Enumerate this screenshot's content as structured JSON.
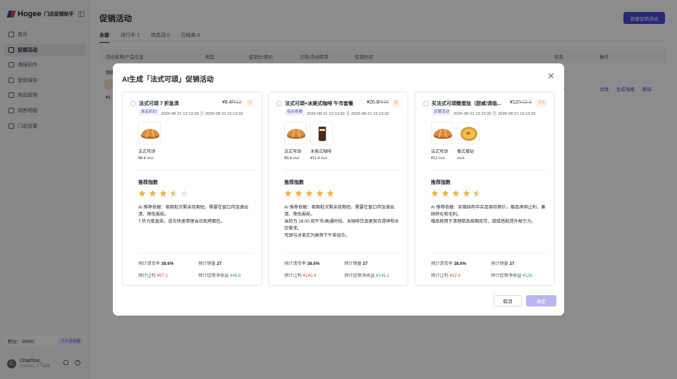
{
  "sidebar": {
    "brand": "Hogee",
    "brand_sub": "门店促销助手",
    "items": [
      {
        "label": "首页"
      },
      {
        "label": "促销活动"
      },
      {
        "label": "海报创作"
      },
      {
        "label": "复盘报告"
      },
      {
        "label": "商品管理"
      },
      {
        "label": "销售明细"
      },
      {
        "label": "门店设置"
      }
    ],
    "points_label": "积分：20000",
    "points_badge": "个人专业版",
    "user_initial": "C",
    "user_name": "CharlSss_",
    "user_sub": "CharlSss_个人版账"
  },
  "page": {
    "title": "促销活动",
    "new_button": "新建促销活动",
    "tabs": [
      {
        "label": "全部"
      },
      {
        "label": "进行中 1"
      },
      {
        "label": "待启动 0"
      },
      {
        "label": "已结束 0"
      }
    ],
    "columns": [
      "活动名称/产品信息",
      "类型",
      "促销价/原价",
      "已售/活动库存",
      "促销时间",
      "状态",
      "操作"
    ],
    "row": {
      "name_fragment": "烘焙",
      "price_fragment": "¥1",
      "status": "行中",
      "actions": [
        "详情",
        "生成海报",
        "删除"
      ]
    }
  },
  "modal": {
    "title": "AI生成「法式可颂」促销活动",
    "rec_label": "推荐指数",
    "time_sep": "至",
    "cancel": "取消",
    "confirm": "确定",
    "metric_labels": {
      "clear_rate": "预计清货率",
      "sales": "预计销量",
      "discount": "预计让利",
      "net_income": "预计促销净收益"
    },
    "cards": [
      {
        "name": "法式可颂 7 折急清",
        "price": "¥8.4/",
        "original_price": "¥12",
        "discount": "7",
        "type": "单品折扣",
        "start": "2026-08-21 12:13:32",
        "end": "2026-08-21 15:13:32",
        "products": [
          {
            "name": "法式可颂",
            "price": "¥8.4",
            "original": "¥12",
            "image": "croissant"
          }
        ],
        "rating": 3.5,
        "reason": [
          "AI 推荐依据：临期批次剩余效期短，需要在窗口内加速出清、降低报损。",
          "7 折力度直接，适合快速清理当日现烤面包。"
        ],
        "clear_rate": "38.6%",
        "sales": "27",
        "discount_amount": "¥97.2",
        "net_income": "¥46.8"
      },
      {
        "name": "法式可颂+冰美式咖啡 午市套餐",
        "price": "¥20.8/",
        "original_price": "¥26",
        "discount": "8",
        "type": "组合套餐",
        "start": "2026-08-21 12:13:32",
        "end": "2026-08-21 15:13:32",
        "products": [
          {
            "name": "法式可颂",
            "price": "¥9.4",
            "original": "¥12",
            "image": "croissant"
          },
          {
            "name": "冰美式咖啡",
            "price": "¥11.4",
            "original": "¥14",
            "image": "coffee"
          }
        ],
        "rating": 5,
        "reason": [
          "AI 推荐依据：临期批次剩余效期短，需要在窗口内加速出清、降低报损。",
          "当前为 16:00 前午市/高通时段，含咖啡饮品更契合提神和水饮需求。",
          "可颂与冰美式为高频下午茶组合。"
        ],
        "clear_rate": "38.6%",
        "sales": "27",
        "discount_amount": "¥140.4",
        "net_income": "¥145.2"
      },
      {
        "name": "买法式可颂赠蛋挞（甜咸/清临...",
        "price": "¥12/",
        "original_price": "¥15.5",
        "discount": "7.7",
        "type": "买赠活动",
        "start": "2026-08-21 12:13:32",
        "end": "2026-08-21 15:13:32",
        "products": [
          {
            "name": "法式可颂",
            "price": "¥12",
            "original": "¥12",
            "image": "croissant"
          },
          {
            "name": "葡式蛋挞",
            "price": "",
            "original": "¥3.5",
            "image": "tart"
          }
        ],
        "rating": 4.5,
        "reason": [
          "AI 推荐依据：买赠结构中买品保持原价，赠品承担让利，兼顾转化和毛利。",
          "赠品挑用于清理甜品临期库存，甜咸搭配提升吸引力。"
        ],
        "clear_rate": "38.6%",
        "sales": "27",
        "discount_amount": "¥32.4",
        "net_income": "¥126"
      }
    ]
  },
  "colors": {
    "accent": "#4b4bd8",
    "star": "#f2b43b",
    "star_empty": "#e5e6eb",
    "red": "#e8503a",
    "green": "#2ea86a"
  }
}
